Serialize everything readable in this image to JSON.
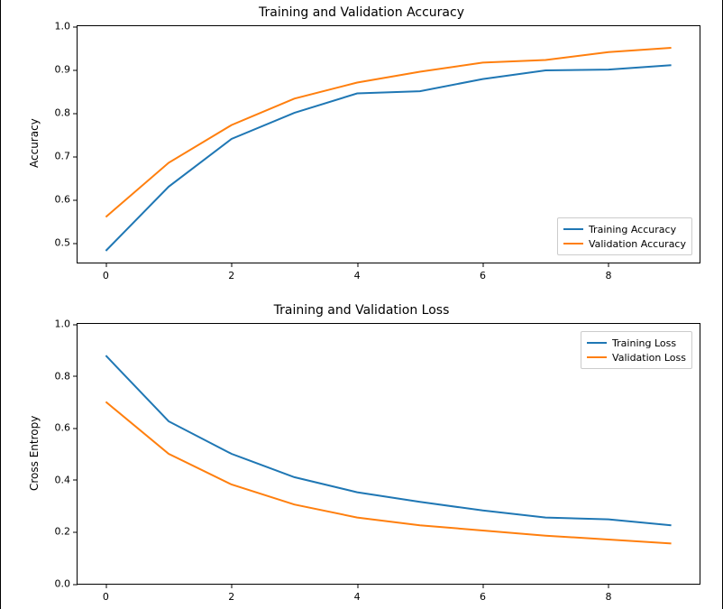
{
  "chart_data": [
    {
      "type": "line",
      "title": "Training and Validation Accuracy",
      "xlabel": "",
      "ylabel": "Accuracy",
      "xlim": [
        -0.45,
        9.45
      ],
      "ylim": [
        0.455,
        1.0
      ],
      "xticks": [
        0,
        2,
        4,
        6,
        8
      ],
      "yticks": [
        0.5,
        0.6,
        0.7,
        0.8,
        0.9,
        1.0
      ],
      "x": [
        0,
        1,
        2,
        3,
        4,
        5,
        6,
        7,
        8,
        9
      ],
      "series": [
        {
          "name": "Training Accuracy",
          "color": "#1f77b4",
          "values": [
            0.482,
            0.63,
            0.74,
            0.8,
            0.845,
            0.85,
            0.878,
            0.898,
            0.9,
            0.91
          ]
        },
        {
          "name": "Validation Accuracy",
          "color": "#ff7f0e",
          "values": [
            0.56,
            0.685,
            0.772,
            0.833,
            0.87,
            0.895,
            0.916,
            0.922,
            0.94,
            0.95
          ]
        }
      ],
      "legend_pos": "lower-right"
    },
    {
      "type": "line",
      "title": "Training and Validation Loss",
      "xlabel": "",
      "ylabel": "Cross Entropy",
      "xlim": [
        -0.45,
        9.45
      ],
      "ylim": [
        0.0,
        1.0
      ],
      "xticks": [
        0,
        2,
        4,
        6,
        8
      ],
      "yticks": [
        0.0,
        0.2,
        0.4,
        0.6,
        0.8,
        1.0
      ],
      "x": [
        0,
        1,
        2,
        3,
        4,
        5,
        6,
        7,
        8,
        9
      ],
      "series": [
        {
          "name": "Training Loss",
          "color": "#1f77b4",
          "values": [
            0.878,
            0.625,
            0.5,
            0.41,
            0.352,
            0.315,
            0.282,
            0.255,
            0.248,
            0.225
          ]
        },
        {
          "name": "Validation Loss",
          "color": "#ff7f0e",
          "values": [
            0.7,
            0.5,
            0.382,
            0.305,
            0.255,
            0.225,
            0.205,
            0.185,
            0.17,
            0.155
          ]
        }
      ],
      "legend_pos": "upper-right"
    }
  ]
}
